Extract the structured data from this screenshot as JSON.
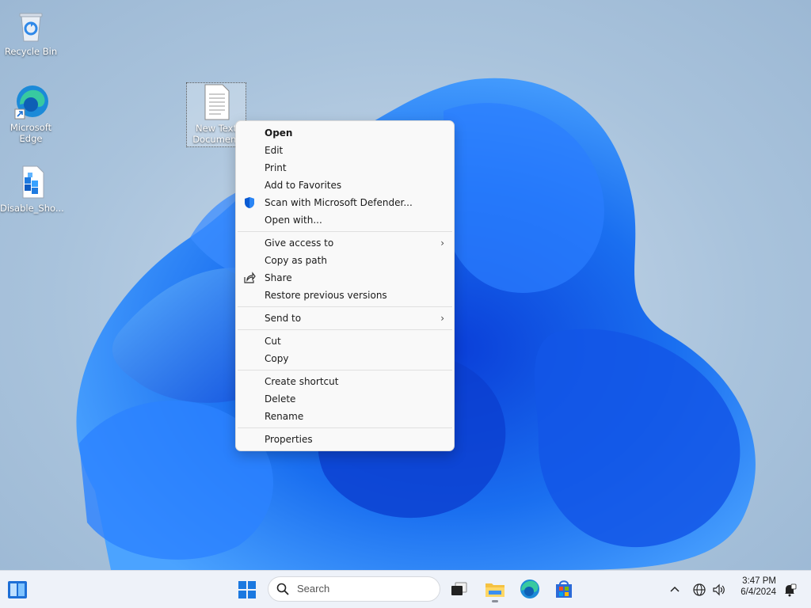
{
  "desktop": {
    "icons": [
      {
        "label": "Recycle Bin"
      },
      {
        "label": "Microsoft Edge"
      },
      {
        "label": "Disable_Sho..."
      },
      {
        "label": "New Text Document"
      }
    ]
  },
  "context_menu": {
    "items": {
      "open": "Open",
      "edit": "Edit",
      "print": "Print",
      "add_favorites": "Add to Favorites",
      "scan_defender": "Scan with Microsoft Defender...",
      "open_with": "Open with...",
      "give_access": "Give access to",
      "copy_path": "Copy as path",
      "share": "Share",
      "restore_versions": "Restore previous versions",
      "send_to": "Send to",
      "cut": "Cut",
      "copy": "Copy",
      "create_shortcut": "Create shortcut",
      "delete": "Delete",
      "rename": "Rename",
      "properties": "Properties"
    }
  },
  "taskbar": {
    "search_placeholder": "Search",
    "time": "3:47 PM",
    "date": "6/4/2024",
    "pinned": [
      "widgets-icon",
      "start-icon",
      "task-view-icon",
      "file-explorer-icon",
      "edge-icon",
      "store-icon"
    ]
  },
  "colors": {
    "accent": "#0067c0",
    "bloom_blue": "#1a6ff0",
    "menu_bg": "#f9f9f9",
    "taskbar_bg": "#eef2f9"
  }
}
